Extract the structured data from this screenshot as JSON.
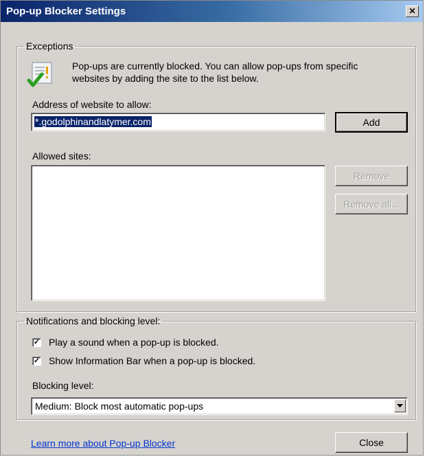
{
  "window": {
    "title": "Pop-up Blocker Settings",
    "close_glyph": "✕"
  },
  "exceptions": {
    "legend": "Exceptions",
    "info_line1": "Pop-ups are currently blocked.  You can allow pop-ups from specific",
    "info_line2": "websites by adding the site to the list below.",
    "address_label": "Address of website to allow:",
    "address_value": "*.godolphinandlatymer.com",
    "add_label": "Add",
    "allowed_label": "Allowed sites:",
    "remove_label": "Remove",
    "remove_all_label": "Remove all..."
  },
  "notifications": {
    "legend": "Notifications and blocking level:",
    "play_sound_label": "Play a sound when a pop-up is blocked.",
    "play_sound_checked": true,
    "info_bar_label": "Show Information Bar when a pop-up is blocked.",
    "info_bar_checked": true,
    "blocking_level_label": "Blocking level:",
    "blocking_level_value": "Medium: Block most automatic pop-ups"
  },
  "footer": {
    "learn_more_label": "Learn more about Pop-up Blocker",
    "close_label": "Close"
  },
  "colors": {
    "title_gradient_start": "#0a246a",
    "dialog_bg": "#d6d3ce",
    "link": "#0033cc",
    "selection": "#0a246a"
  },
  "icons": {
    "info": "document-with-exclamation-and-checkmark-icon",
    "dropdown": "chevron-down-icon"
  }
}
